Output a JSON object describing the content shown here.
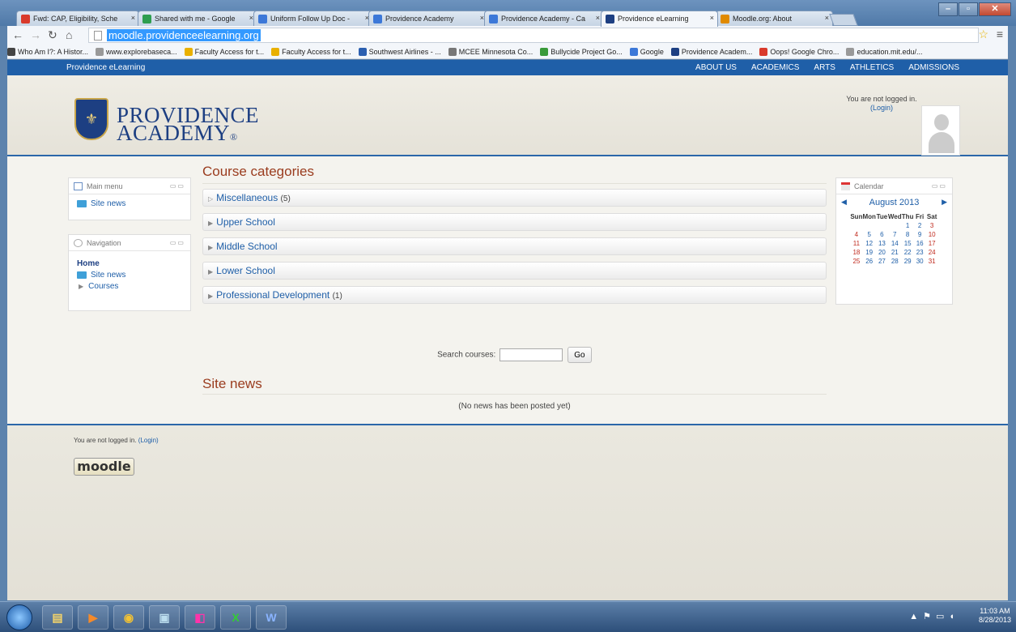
{
  "browser": {
    "tabs": [
      {
        "label": "Fwd: CAP, Eligibility, Sche",
        "icon": "gmail-icon",
        "color": "#d93a2b",
        "active": false
      },
      {
        "label": "Shared with me - Google",
        "icon": "drive-icon",
        "color": "#2e9e4f",
        "active": false
      },
      {
        "label": "Uniform Follow Up Doc -",
        "icon": "docs-icon",
        "color": "#3c78d8",
        "active": false
      },
      {
        "label": "Providence Academy",
        "icon": "google-icon",
        "color": "#3c78d8",
        "active": false
      },
      {
        "label": "Providence Academy - Ca",
        "icon": "calendar-icon",
        "color": "#3c78d8",
        "active": false
      },
      {
        "label": "Providence eLearning",
        "icon": "moodle-icon",
        "color": "#1d3f82",
        "active": true
      },
      {
        "label": "Moodle.org: About",
        "icon": "moodle-icon",
        "color": "#e08a00",
        "active": false
      }
    ],
    "url": "moodle.providenceelearning.org",
    "bookmarks": [
      "Who Am I?: A Histor...",
      "www.explorebaseca...",
      "Faculty Access for t...",
      "Faculty Access for t...",
      "Southwest Airlines - ...",
      "MCEE Minnesota Co...",
      "Bullycide Project Go...",
      "Google",
      "Providence Academ...",
      "Oops! Google Chro...",
      "education.mit.edu/..."
    ]
  },
  "site": {
    "brand": "Providence eLearning",
    "nav": [
      "ABOUT US",
      "ACADEMICS",
      "ARTS",
      "ATHLETICS",
      "ADMISSIONS"
    ],
    "logo_line1": "PROVIDENCE",
    "logo_line2": "ACADEMY",
    "logo_mark": "®",
    "login_text": "You are not logged in.",
    "login_link": "(Login)"
  },
  "main_menu": {
    "title": "Main menu",
    "items": [
      "Site news"
    ]
  },
  "navigation": {
    "title": "Navigation",
    "home": "Home",
    "site_news": "Site news",
    "courses": "Courses"
  },
  "course_categories": {
    "title": "Course categories",
    "items": [
      {
        "name": "Miscellaneous",
        "count": "(5)"
      },
      {
        "name": "Upper School",
        "count": ""
      },
      {
        "name": "Middle School",
        "count": ""
      },
      {
        "name": "Lower School",
        "count": ""
      },
      {
        "name": "Professional Development",
        "count": "(1)"
      }
    ]
  },
  "search": {
    "label": "Search courses:",
    "value": "",
    "button": "Go"
  },
  "site_news": {
    "title": "Site news",
    "empty": "(No news has been posted yet)"
  },
  "calendar": {
    "title": "Calendar",
    "month": "August 2013",
    "days": [
      "Sun",
      "Mon",
      "Tue",
      "Wed",
      "Thu",
      "Fri",
      "Sat"
    ],
    "weeks": [
      [
        "",
        "",
        "",
        "",
        "1",
        "2",
        "3"
      ],
      [
        "4",
        "5",
        "6",
        "7",
        "8",
        "9",
        "10"
      ],
      [
        "11",
        "12",
        "13",
        "14",
        "15",
        "16",
        "17"
      ],
      [
        "18",
        "19",
        "20",
        "21",
        "22",
        "23",
        "24"
      ],
      [
        "25",
        "26",
        "27",
        "28",
        "29",
        "30",
        "31"
      ]
    ]
  },
  "footer": {
    "text": "You are not logged in.",
    "link": "(Login)",
    "logo": "moodle"
  },
  "taskbar": {
    "time": "11:03 AM",
    "date": "8/28/2013"
  }
}
